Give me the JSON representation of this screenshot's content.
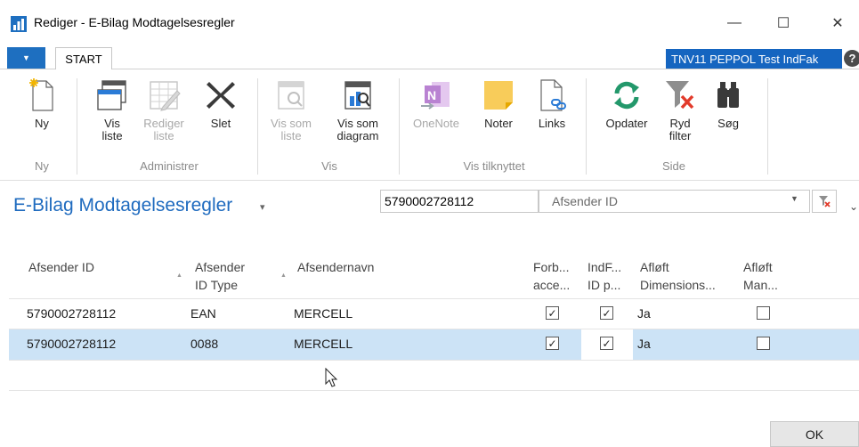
{
  "window": {
    "title": "Rediger - E-Bilag Modtagelsesregler",
    "minimize": "—",
    "maximize": "☐",
    "close": "✕"
  },
  "ribbon_tabs": {
    "menu_glyph": "▼",
    "start": "START",
    "company": "TNV11 PEPPOL Test IndFak",
    "help": "?"
  },
  "ribbon": {
    "new": {
      "label": "Ny",
      "icon": "new-document-icon"
    },
    "view_list": {
      "label": "Vis\nliste",
      "icon": "view-list-icon"
    },
    "edit_list": {
      "label": "Rediger\nliste",
      "icon": "edit-list-icon",
      "disabled": true
    },
    "delete": {
      "label": "Slet",
      "icon": "delete-x-icon"
    },
    "view_as_list": {
      "label": "Vis som\nliste",
      "icon": "view-as-list-icon",
      "disabled": true
    },
    "view_as_chart": {
      "label": "Vis som\ndiagram",
      "icon": "chart-icon"
    },
    "onenote": {
      "label": "OneNote",
      "icon": "onenote-icon",
      "disabled": true
    },
    "notes": {
      "label": "Noter",
      "icon": "sticky-note-icon"
    },
    "links": {
      "label": "Links",
      "icon": "link-document-icon"
    },
    "refresh": {
      "label": "Opdater",
      "icon": "refresh-icon"
    },
    "clear_filter": {
      "label": "Ryd\nfilter",
      "icon": "clear-filter-icon"
    },
    "find": {
      "label": "Søg",
      "icon": "binoculars-icon"
    },
    "groups": {
      "new": "Ny",
      "manage": "Administrer",
      "view": "Vis",
      "view_attached": "Vis tilknyttet",
      "page": "Side"
    }
  },
  "page": {
    "title": "E-Bilag Modtagelsesregler",
    "title_caret": "▾",
    "filter_value": "5790002728112",
    "filter_field": "Afsender ID",
    "filter_dropdown": "▼",
    "expand": "⌄"
  },
  "grid": {
    "headers": {
      "sender_id": "Afsender ID",
      "sender_id_type_1": "Afsender",
      "sender_id_type_2": "ID Type",
      "sender_name": "Afsendernavn",
      "forb_1": "Forb...",
      "forb_2": "acce...",
      "indf_1": "IndF...",
      "indf_2": "ID p...",
      "afloft_dim_1": "Afløft",
      "afloft_dim_2": "Dimensions...",
      "afloft_man_1": "Afløft",
      "afloft_man_2": "Man..."
    },
    "rows": [
      {
        "sender_id": "5790002728112",
        "id_type": "EAN",
        "name": "MERCELL",
        "forb": true,
        "indf": true,
        "dim": "Ja",
        "man": false
      },
      {
        "sender_id": "5790002728112",
        "id_type": "0088",
        "name": "MERCELL",
        "forb": true,
        "indf": true,
        "dim": "Ja",
        "man": false
      }
    ]
  },
  "footer": {
    "ok": "OK"
  },
  "colors": {
    "accent": "#1f6bbf",
    "selected_row": "#cce3f6",
    "company_badge": "#1565c0"
  }
}
